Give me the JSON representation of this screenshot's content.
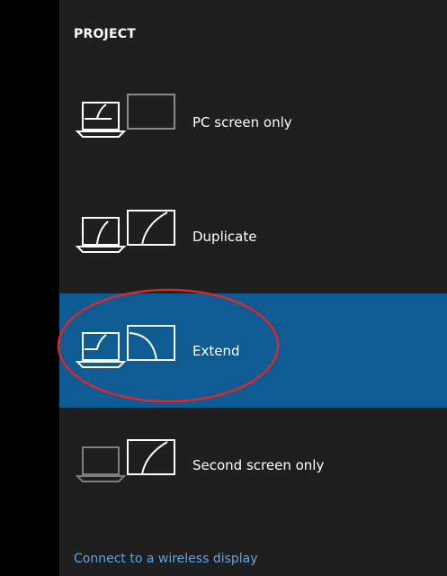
{
  "panel": {
    "title": "PROJECT",
    "options": [
      {
        "label": "PC screen only",
        "icon": "pc-screen-only-icon",
        "selected": false
      },
      {
        "label": "Duplicate",
        "icon": "duplicate-icon",
        "selected": false
      },
      {
        "label": "Extend",
        "icon": "extend-icon",
        "selected": true
      },
      {
        "label": "Second screen only",
        "icon": "second-screen-only-icon",
        "selected": false
      }
    ],
    "wireless_link": "Connect to a wireless display"
  },
  "colors": {
    "panel_bg": "#1f1f1f",
    "selected_bg": "#0f5b93",
    "link": "#5aa7e8",
    "annotation": "#d42a2a"
  }
}
